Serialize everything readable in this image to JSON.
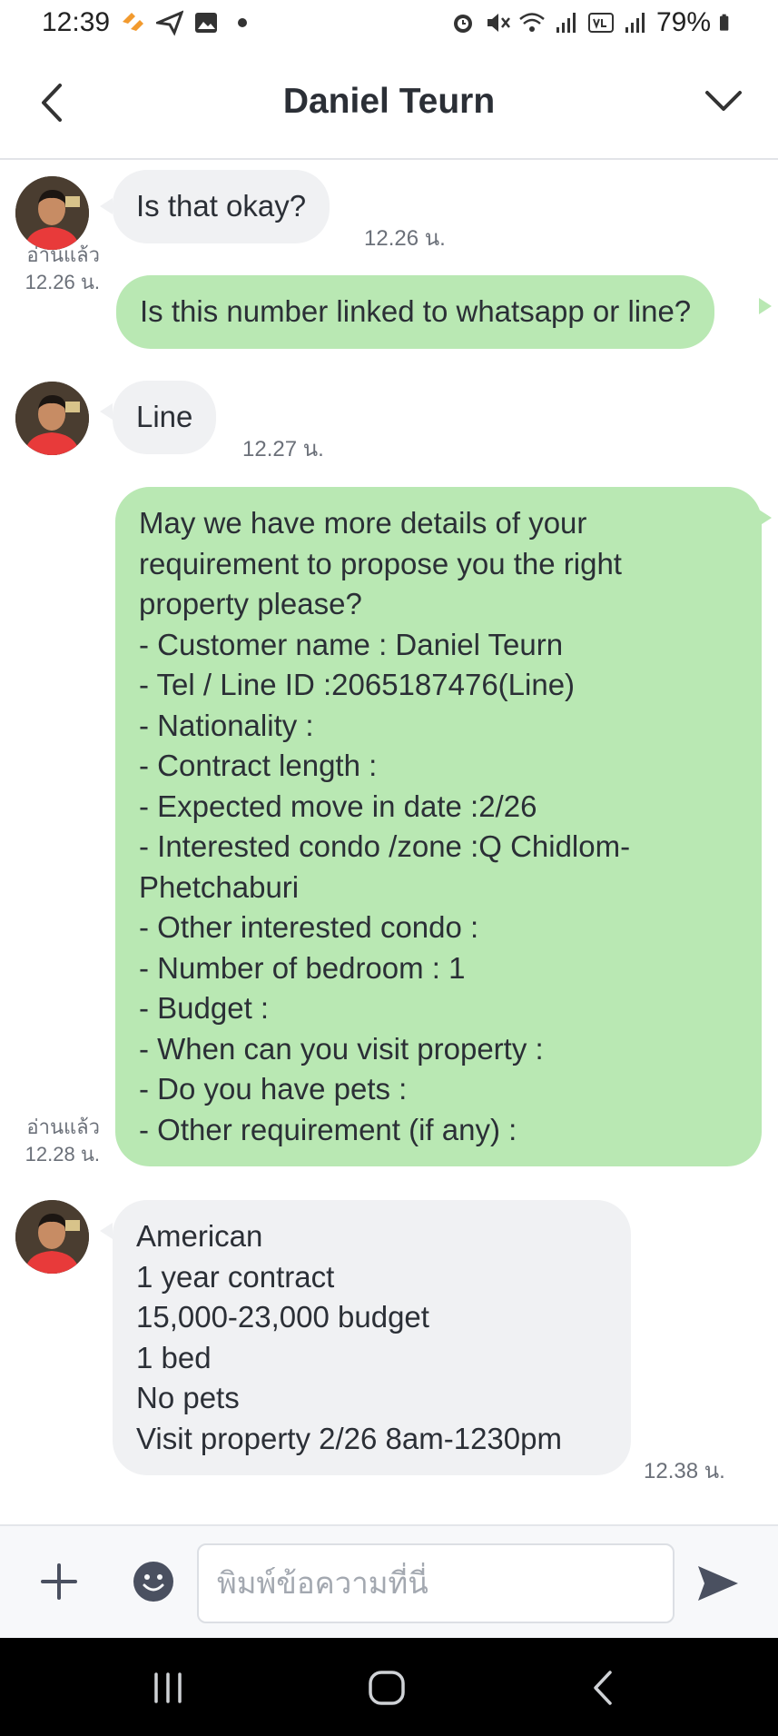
{
  "status_bar": {
    "time": "12:39",
    "battery": "79%",
    "left_icons": [
      "flash-icon",
      "send-icon",
      "gallery-icon",
      "dot-icon"
    ],
    "right_icons": [
      "alarm-icon",
      "mute-icon",
      "wifi-icon",
      "signal-icon",
      "volte-icon",
      "signal-icon",
      "battery-icon"
    ]
  },
  "header": {
    "title": "Daniel Teurn",
    "back_icon": "chevron-left-icon",
    "menu_icon": "chevron-down-icon"
  },
  "messages": [
    {
      "direction": "incoming",
      "text": "Is that okay?",
      "time": "12.26 น."
    },
    {
      "direction": "outgoing",
      "text": "Is this number linked to whatsapp or line?",
      "read_label": "อ่านแล้ว",
      "time": "12.26 น."
    },
    {
      "direction": "incoming",
      "text": "Line",
      "time": "12.27 น."
    },
    {
      "direction": "outgoing",
      "text": "May we have more details of your\nrequirement to propose you the right\nproperty please?\n- Customer name : Daniel Teurn\n- Tel / Line ID :2065187476(Line)\n- Nationality :\n- Contract length :\n- Expected move in date :2/26\n- Interested condo /zone :Q Chidlom-\nPhetchaburi\n- Other interested condo :\n- Number of bedroom  : 1\n- Budget :\n- When can you visit property :\n- Do you have pets :\n- Other requirement (if any) :",
      "read_label": "อ่านแล้ว",
      "time": "12.28 น."
    },
    {
      "direction": "incoming",
      "text": "American\n1 year contract\n15,000-23,000 budget\n1 bed\nNo pets\nVisit property 2/26 8am-1230pm",
      "time": "12.38 น."
    }
  ],
  "composer": {
    "placeholder": "พิมพ์ข้อความที่นี่",
    "value": "",
    "icons": [
      "plus-icon",
      "emoji-icon",
      "send-icon"
    ]
  },
  "nav": {
    "icons": [
      "recents-icon",
      "home-icon",
      "back-icon"
    ]
  },
  "colors": {
    "outgoing_bubble": "#b9e8b3",
    "incoming_bubble": "#f0f1f3",
    "nav_bar": "#000000"
  }
}
